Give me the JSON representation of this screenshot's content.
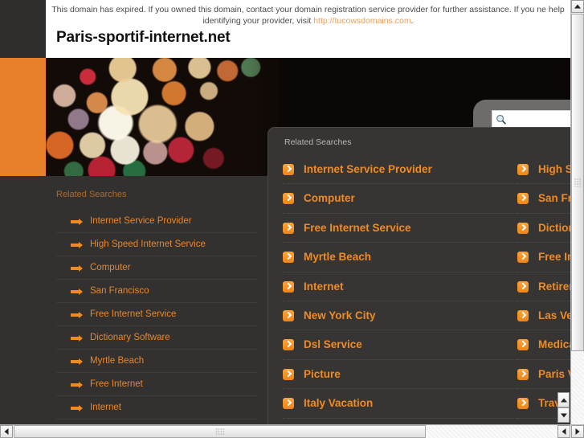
{
  "banner": {
    "message_prefix": "This domain has expired. If you owned this domain, contact your domain registration service provider for further assistance. If you ne",
    "message_line2_prefix": "help identifying your provider, visit ",
    "link_text": "http://tucowsdomains.com",
    "message_suffix": "."
  },
  "domain": {
    "title": "Paris-sportif-internet.net"
  },
  "hero": {
    "search_placeholder": "",
    "search_icon": "magnifier-icon"
  },
  "sidebar": {
    "title": "Related Searches",
    "items": [
      {
        "label": "Internet Service Provider"
      },
      {
        "label": "High Speed Internet Service"
      },
      {
        "label": "Computer"
      },
      {
        "label": "San Francisco"
      },
      {
        "label": "Free Internet Service"
      },
      {
        "label": "Dictionary Software"
      },
      {
        "label": "Myrtle Beach"
      },
      {
        "label": "Free Internet"
      },
      {
        "label": "Internet"
      }
    ]
  },
  "overlay": {
    "title": "Related Searches",
    "left_column": [
      {
        "label": "Internet Service Provider"
      },
      {
        "label": "Computer"
      },
      {
        "label": "Free Internet Service"
      },
      {
        "label": "Myrtle Beach"
      },
      {
        "label": "Internet"
      },
      {
        "label": "New York City"
      },
      {
        "label": "Dsl Service"
      },
      {
        "label": "Picture"
      },
      {
        "label": "Italy Vacation"
      }
    ],
    "right_column": [
      {
        "label": "High Sp"
      },
      {
        "label": "San Fra"
      },
      {
        "label": "Diction"
      },
      {
        "label": "Free Int"
      },
      {
        "label": "Retirem"
      },
      {
        "label": "Las Veg"
      },
      {
        "label": "Medica"
      },
      {
        "label": "Paris V"
      },
      {
        "label": "Travel"
      }
    ]
  },
  "colors": {
    "accent_orange": "#f08a22",
    "brand_orange_block": "#e8802a",
    "dark_bg": "#333130",
    "panel_bg": "#373533",
    "link_orange": "#e8a05c"
  },
  "scrollbars": {
    "vertical_outer": "page-vertical-scrollbar",
    "horizontal": "page-horizontal-scrollbar",
    "vertical_inner": "overlay-vertical-scrollbar"
  }
}
